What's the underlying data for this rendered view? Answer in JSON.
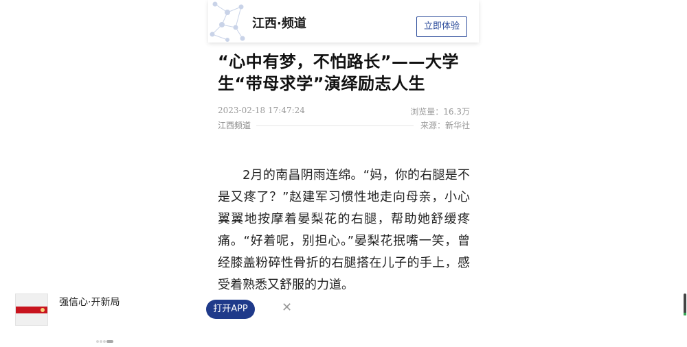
{
  "header": {
    "channel_title": "江西·频道",
    "try_button": "立即体验",
    "logo_icon": "network-pattern-icon"
  },
  "article": {
    "headline": "“心中有梦，不怕路长”——大学生“带母求学”演绎励志人生",
    "datetime": "2023-02-18 17:47:24",
    "views": "浏览量：16.3万",
    "channel": "江西频道",
    "source": "来源：新华社",
    "paragraph": "2月的南昌阴雨连绵。“妈，你的右腿是不是又疼了？”赵建军习惯性地走向母亲，小心翼翼地按摩着晏梨花的右腿，帮助她舒缓疼痛。“好着呢，别担心。”晏梨花抿嘴一笑，曾经膝盖粉碎性骨折的右腿搭在儿子的手上，感受着熟悉又舒服的力道。"
  },
  "promo": {
    "title": "强信心·开新局",
    "open_app": "打开APP",
    "close_icon": "close-icon"
  },
  "colors": {
    "accent": "#1f3a8a",
    "meta_text": "#999999",
    "promo_band": "#c8141e"
  }
}
